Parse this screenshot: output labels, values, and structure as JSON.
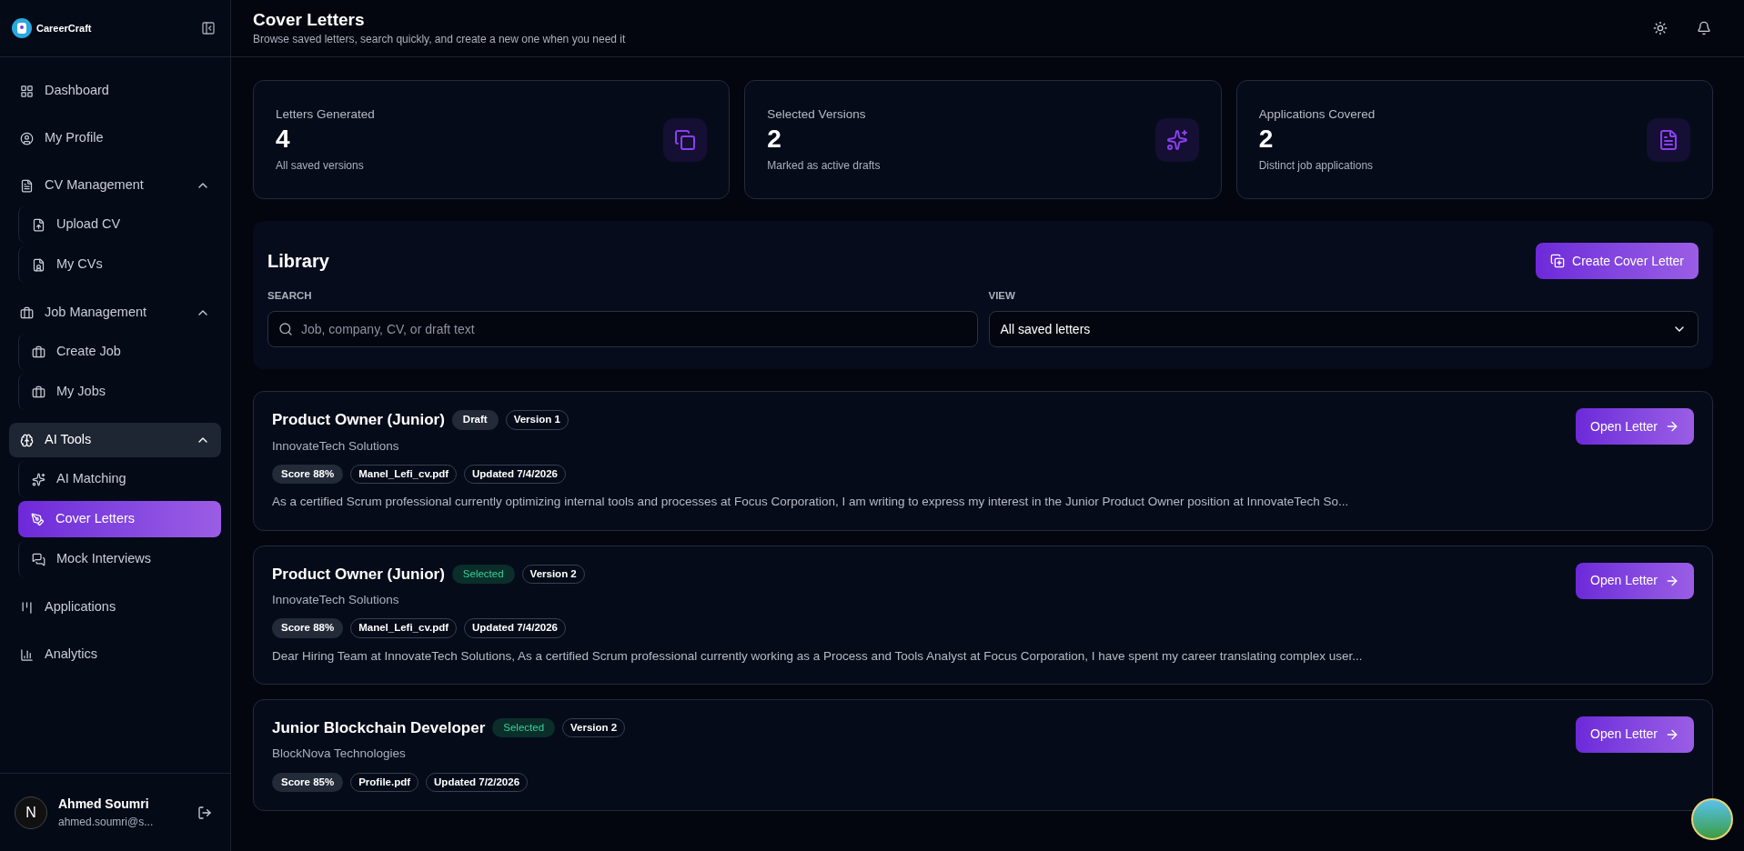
{
  "brand": {
    "name": "CareerCraft"
  },
  "sidebar": {
    "items": [
      {
        "label": "Dashboard",
        "selected": false
      },
      {
        "label": "My Profile",
        "selected": false
      },
      {
        "label": "CV Management",
        "selected": false,
        "expanded": true,
        "children": [
          {
            "label": "Upload CV",
            "selected": false
          },
          {
            "label": "My CVs",
            "selected": false
          }
        ]
      },
      {
        "label": "Job Management",
        "selected": false,
        "expanded": true,
        "children": [
          {
            "label": "Create Job",
            "selected": false
          },
          {
            "label": "My Jobs",
            "selected": false
          }
        ]
      },
      {
        "label": "AI Tools",
        "selected": true,
        "expanded": true,
        "children": [
          {
            "label": "AI Matching",
            "selected": false
          },
          {
            "label": "Cover Letters",
            "selected": true
          },
          {
            "label": "Mock Interviews",
            "selected": false
          }
        ]
      },
      {
        "label": "Applications",
        "selected": false
      },
      {
        "label": "Analytics",
        "selected": false
      }
    ],
    "user": {
      "initial": "N",
      "name": "Ahmed Soumri",
      "email": "ahmed.soumri@s..."
    }
  },
  "header": {
    "title": "Cover Letters",
    "subtitle": "Browse saved letters, search quickly, and create a new one when you need it"
  },
  "stats": [
    {
      "label": "Letters Generated",
      "value": "4",
      "note": "All saved versions"
    },
    {
      "label": "Selected Versions",
      "value": "2",
      "note": "Marked as active drafts"
    },
    {
      "label": "Applications Covered",
      "value": "2",
      "note": "Distinct job applications"
    }
  ],
  "library": {
    "title": "Library",
    "create_button": "Create Cover Letter",
    "search_label": "SEARCH",
    "search_placeholder": "Job, company, CV, or draft text",
    "view_label": "VIEW",
    "view_value": "All saved letters"
  },
  "letters": [
    {
      "title": "Product Owner (Junior)",
      "status": {
        "label": "Draft",
        "kind": "draft"
      },
      "version": "Version 1",
      "company": "InnovateTech Solutions",
      "tags": [
        "Score 88%",
        "Manel_Lefi_cv.pdf",
        "Updated 7/4/2026"
      ],
      "excerpt": "As a certified Scrum professional currently optimizing internal tools and processes at Focus Corporation, I am writing to express my interest in the Junior Product Owner position at InnovateTech So...",
      "button": "Open Letter"
    },
    {
      "title": "Product Owner (Junior)",
      "status": {
        "label": "Selected",
        "kind": "selected"
      },
      "version": "Version 2",
      "company": "InnovateTech Solutions",
      "tags": [
        "Score 88%",
        "Manel_Lefi_cv.pdf",
        "Updated 7/4/2026"
      ],
      "excerpt": "Dear Hiring Team at InnovateTech Solutions, As a certified Scrum professional currently working as a Process and Tools Analyst at Focus Corporation, I have spent my career translating complex user...",
      "button": "Open Letter"
    },
    {
      "title": "Junior Blockchain Developer",
      "status": {
        "label": "Selected",
        "kind": "selected"
      },
      "version": "Version 2",
      "company": "BlockNova Technologies",
      "tags": [
        "Score 85%",
        "Profile.pdf",
        "Updated 7/2/2026"
      ],
      "button": "Open Letter"
    }
  ]
}
